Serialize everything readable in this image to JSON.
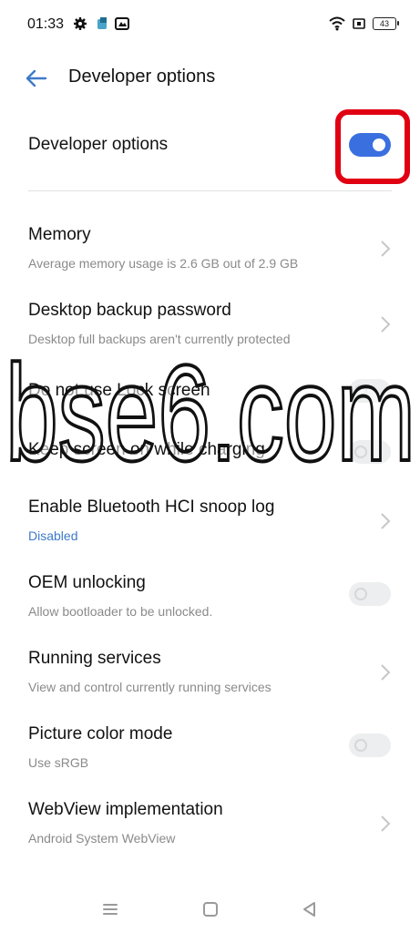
{
  "status_bar": {
    "time": "01:33",
    "icons": [
      "gear-icon",
      "app-icon",
      "gallery-icon"
    ],
    "right_icons": [
      "wifi-icon",
      "sim-icon"
    ],
    "battery": "43"
  },
  "header": {
    "title": "Developer options"
  },
  "master": {
    "label": "Developer options",
    "enabled": true
  },
  "rows": [
    {
      "title": "Memory",
      "subtitle": "Average memory usage is 2.6 GB out of 2.9 GB",
      "control": "chevron"
    },
    {
      "title": "Desktop backup password",
      "subtitle": "Desktop full backups aren't currently protected",
      "control": "chevron"
    },
    {
      "title": "Do not use Lock screen",
      "subtitle": "",
      "control": "switch"
    },
    {
      "title": "Keep screen on while charging",
      "subtitle": "",
      "control": "switch"
    },
    {
      "title": "Enable Bluetooth HCI snoop log",
      "subtitle": "Disabled",
      "control": "chevron"
    },
    {
      "title": "OEM unlocking",
      "subtitle": "Allow bootloader to be unlocked.",
      "control": "switch"
    },
    {
      "title": "Running services",
      "subtitle": "View and control currently running services",
      "control": "chevron"
    },
    {
      "title": "Picture color mode",
      "subtitle": "Use sRGB",
      "control": "switch"
    },
    {
      "title": "WebView implementation",
      "subtitle": "Android System WebView",
      "control": "chevron"
    }
  ],
  "watermark": "bse6.com",
  "colors": {
    "accent": "#3a6fe0",
    "highlight": "#e00012",
    "link": "#3d7ac8"
  }
}
